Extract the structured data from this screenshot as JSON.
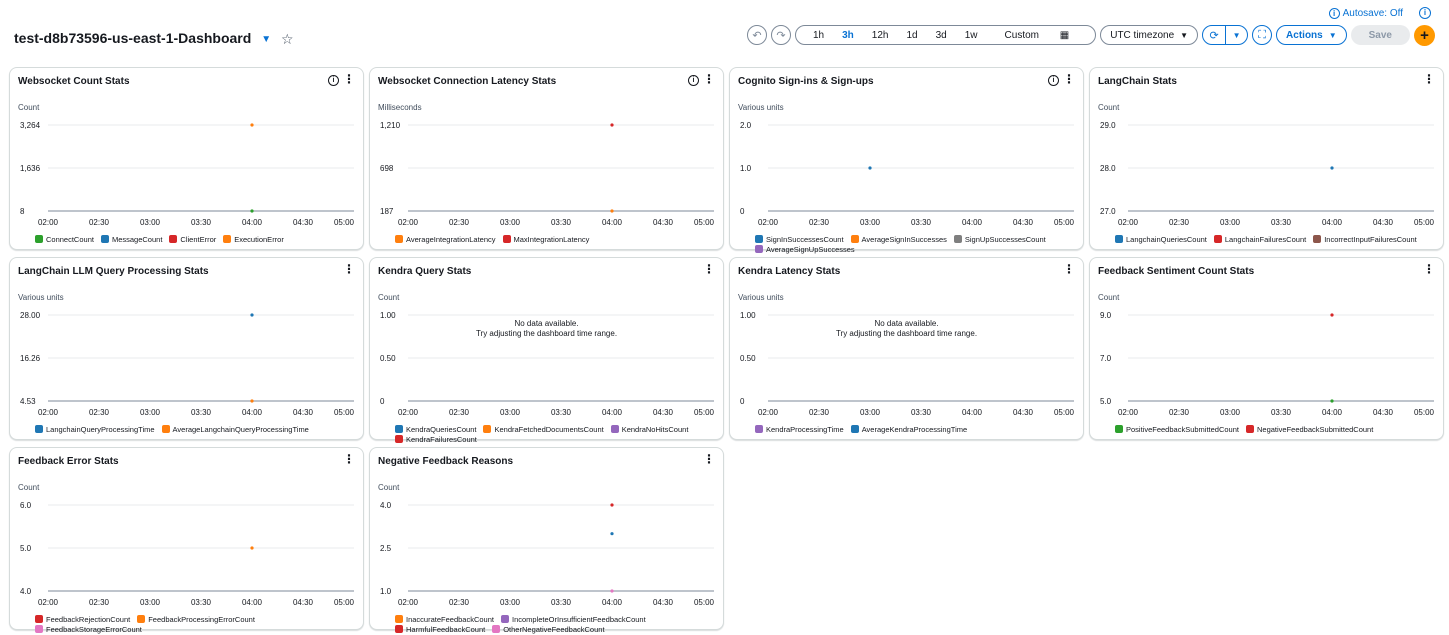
{
  "dashboard": {
    "title": "test-d8b73596-us-east-1-Dashboard",
    "autosave": "Autosave: Off"
  },
  "toolbar": {
    "ranges": [
      "1h",
      "3h",
      "12h",
      "1d",
      "3d",
      "1w"
    ],
    "active_range": "3h",
    "custom_label": "Custom",
    "timezone_label": "UTC timezone",
    "actions_label": "Actions",
    "save_label": "Save"
  },
  "colors": {
    "green": "#2ca02c",
    "blue": "#1f77b4",
    "red": "#d62728",
    "orange": "#ff7f0e",
    "purple": "#9467bd",
    "gray": "#7f7f7f",
    "brown": "#8c564b",
    "pink": "#e377c2"
  },
  "x_ticks": [
    "02:00",
    "02:30",
    "03:00",
    "03:30",
    "04:00",
    "04:30",
    "05:00"
  ],
  "no_data": {
    "line1": "No data available.",
    "line2": "Try adjusting the dashboard time range."
  },
  "widgets": [
    {
      "title": "Websocket Count Stats",
      "info": true,
      "unit": "Count",
      "y_ticks": [
        "3,264",
        "1,636",
        "8"
      ],
      "y_values": [
        3264,
        1636,
        8
      ],
      "legend": [
        {
          "name": "ConnectCount",
          "color": "green"
        },
        {
          "name": "MessageCount",
          "color": "blue"
        },
        {
          "name": "ClientError",
          "color": "red"
        },
        {
          "name": "ExecutionError",
          "color": "orange"
        }
      ],
      "points": [
        {
          "x": "04:00",
          "y": 3264,
          "color": "orange"
        },
        {
          "x": "04:00",
          "y": 8,
          "color": "green"
        }
      ]
    },
    {
      "title": "Websocket Connection Latency Stats",
      "info": true,
      "unit": "Milliseconds",
      "y_ticks": [
        "1,210",
        "698",
        "187"
      ],
      "y_values": [
        1210,
        698,
        187
      ],
      "legend": [
        {
          "name": "AverageIntegrationLatency",
          "color": "orange"
        },
        {
          "name": "MaxIntegrationLatency",
          "color": "red"
        }
      ],
      "points": [
        {
          "x": "04:00",
          "y": 1210,
          "color": "red"
        },
        {
          "x": "04:00",
          "y": 187,
          "color": "orange"
        }
      ]
    },
    {
      "title": "Cognito Sign-ins & Sign-ups",
      "info": true,
      "unit": "Various units",
      "y_ticks": [
        "2.0",
        "1.0",
        "0"
      ],
      "y_values": [
        2,
        1,
        0
      ],
      "legend": [
        {
          "name": "SignInSuccessesCount",
          "color": "blue"
        },
        {
          "name": "AverageSignInSuccesses",
          "color": "orange"
        },
        {
          "name": "SignUpSuccessesCount",
          "color": "gray"
        },
        {
          "name": "AverageSignUpSuccesses",
          "color": "purple"
        }
      ],
      "points": [
        {
          "x": "03:00",
          "y": 1,
          "color": "blue"
        }
      ]
    },
    {
      "title": "LangChain Stats",
      "info": false,
      "unit": "Count",
      "y_ticks": [
        "29.0",
        "28.0",
        "27.0"
      ],
      "y_values": [
        29,
        28,
        27
      ],
      "legend": [
        {
          "name": "LangchainQueriesCount",
          "color": "blue"
        },
        {
          "name": "LangchainFailuresCount",
          "color": "red"
        },
        {
          "name": "IncorrectInputFailuresCount",
          "color": "brown"
        }
      ],
      "points": [
        {
          "x": "04:00",
          "y": 28,
          "color": "blue"
        }
      ]
    },
    {
      "title": "LangChain LLM Query Processing Stats",
      "info": false,
      "unit": "Various units",
      "y_ticks": [
        "28.00",
        "16.26",
        "4.53"
      ],
      "y_values": [
        28,
        16.26,
        4.53
      ],
      "legend": [
        {
          "name": "LangchainQueryProcessingTime",
          "color": "blue"
        },
        {
          "name": "AverageLangchainQueryProcessingTime",
          "color": "orange"
        }
      ],
      "points": [
        {
          "x": "04:00",
          "y": 28,
          "color": "blue"
        },
        {
          "x": "04:00",
          "y": 4.53,
          "color": "orange"
        }
      ]
    },
    {
      "title": "Kendra Query Stats",
      "info": false,
      "unit": "Count",
      "y_ticks": [
        "1.00",
        "0.50",
        "0"
      ],
      "y_values": [
        1,
        0.5,
        0
      ],
      "nodata": true,
      "legend": [
        {
          "name": "KendraQueriesCount",
          "color": "blue"
        },
        {
          "name": "KendraFetchedDocumentsCount",
          "color": "orange"
        },
        {
          "name": "KendraNoHitsCount",
          "color": "purple"
        },
        {
          "name": "KendraFailuresCount",
          "color": "red"
        }
      ],
      "points": []
    },
    {
      "title": "Kendra Latency Stats",
      "info": false,
      "unit": "Various units",
      "y_ticks": [
        "1.00",
        "0.50",
        "0"
      ],
      "y_values": [
        1,
        0.5,
        0
      ],
      "nodata": true,
      "legend": [
        {
          "name": "KendraProcessingTime",
          "color": "purple"
        },
        {
          "name": "AverageKendraProcessingTime",
          "color": "blue"
        }
      ],
      "points": []
    },
    {
      "title": "Feedback Sentiment Count Stats",
      "info": false,
      "unit": "Count",
      "y_ticks": [
        "9.0",
        "7.0",
        "5.0"
      ],
      "y_values": [
        9,
        7,
        5
      ],
      "legend": [
        {
          "name": "PositiveFeedbackSubmittedCount",
          "color": "green"
        },
        {
          "name": "NegativeFeedbackSubmittedCount",
          "color": "red"
        }
      ],
      "points": [
        {
          "x": "04:00",
          "y": 9,
          "color": "red"
        },
        {
          "x": "04:00",
          "y": 5,
          "color": "green"
        }
      ]
    },
    {
      "title": "Feedback Error Stats",
      "info": false,
      "unit": "Count",
      "y_ticks": [
        "6.0",
        "5.0",
        "4.0"
      ],
      "y_values": [
        6,
        5,
        4
      ],
      "legend": [
        {
          "name": "FeedbackRejectionCount",
          "color": "red"
        },
        {
          "name": "FeedbackProcessingErrorCount",
          "color": "orange"
        },
        {
          "name": "FeedbackStorageErrorCount",
          "color": "pink"
        }
      ],
      "points": [
        {
          "x": "04:00",
          "y": 5,
          "color": "orange"
        }
      ]
    },
    {
      "title": "Negative Feedback Reasons",
      "info": false,
      "unit": "Count",
      "y_ticks": [
        "4.0",
        "2.5",
        "1.0"
      ],
      "y_values": [
        4,
        2.5,
        1
      ],
      "legend": [
        {
          "name": "InaccurateFeedbackCount",
          "color": "orange"
        },
        {
          "name": "IncompleteOrInsufficientFeedbackCount",
          "color": "purple"
        },
        {
          "name": "HarmfulFeedbackCount",
          "color": "red"
        },
        {
          "name": "OtherNegativeFeedbackCount",
          "color": "pink"
        }
      ],
      "points": [
        {
          "x": "04:00",
          "y": 4,
          "color": "red"
        },
        {
          "x": "04:00",
          "y": 3,
          "color": "blue"
        },
        {
          "x": "04:00",
          "y": 1,
          "color": "pink"
        }
      ]
    }
  ]
}
